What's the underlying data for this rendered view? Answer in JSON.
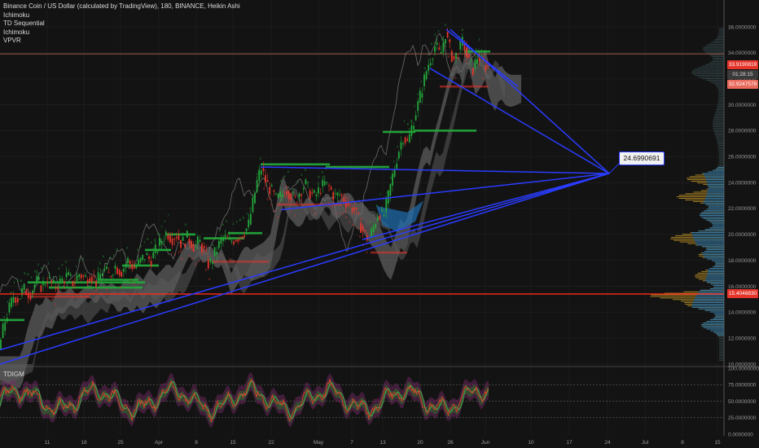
{
  "legend": {
    "title": "Binance Coin / US Dollar (calculated by TradingView), 180, BINANCE, Heikin Ashi",
    "indicators": [
      "Ichimoku",
      "TD Sequential",
      "Ichimoku",
      "VPVR"
    ]
  },
  "lower_pane": {
    "label": "TDIGM"
  },
  "price_tags": {
    "current": "33.9190819",
    "countdown": "01:28:15",
    "second": "32.9247578",
    "support": "15.4048830"
  },
  "callout_value": "24.6990691",
  "colors": {
    "background": "#131313",
    "trendline": "#2a3cff",
    "support_line": "#ff2a1a",
    "bull": "#23a63a",
    "bear": "#e5352b",
    "cloud_light": "#8c8c8c",
    "cloud_blue": "#1f6fb2",
    "vpvr_blue": "#2a86c8",
    "vpvr_gold": "#d4a32a"
  },
  "chart_data": {
    "type": "candlestick",
    "x_tick_labels": [
      "11",
      "18",
      "25",
      "Apr",
      "8",
      "15",
      "22",
      "May",
      "7",
      "13",
      "20",
      "26",
      "Jun",
      "10",
      "17",
      "24",
      "Jul",
      "8",
      "15"
    ],
    "y_tick_labels": [
      "36.0000000",
      "34.0000000",
      "32.0000000",
      "30.0000000",
      "28.0000000",
      "26.0000000",
      "24.0000000",
      "22.0000000",
      "20.0000000",
      "18.0000000",
      "16.0000000",
      "14.0000000",
      "12.0000000",
      "10.0000000"
    ],
    "ylim": [
      10,
      36.3
    ],
    "support_level": 15.404883,
    "price_path": [
      [
        0,
        11.2
      ],
      [
        8,
        13.5
      ],
      [
        14,
        14.5
      ],
      [
        18,
        15.3
      ],
      [
        24,
        15.0
      ],
      [
        30,
        15.8
      ],
      [
        38,
        15.4
      ],
      [
        46,
        16.4
      ],
      [
        52,
        16.0
      ],
      [
        60,
        16.6
      ],
      [
        68,
        15.9
      ],
      [
        76,
        16.4
      ],
      [
        84,
        16.8
      ],
      [
        92,
        16.2
      ],
      [
        98,
        17.0
      ],
      [
        105,
        16.6
      ],
      [
        112,
        16.9
      ],
      [
        120,
        16.3
      ],
      [
        128,
        17.3
      ],
      [
        136,
        16.8
      ],
      [
        142,
        17.6
      ],
      [
        150,
        17.1
      ],
      [
        158,
        18.0
      ],
      [
        166,
        17.4
      ],
      [
        172,
        17.8
      ],
      [
        180,
        18.4
      ],
      [
        186,
        18.0
      ],
      [
        194,
        18.9
      ],
      [
        200,
        19.6
      ],
      [
        206,
        20.2
      ],
      [
        212,
        19.7
      ],
      [
        218,
        20.0
      ],
      [
        224,
        19.3
      ],
      [
        232,
        19.8
      ],
      [
        240,
        19.0
      ],
      [
        246,
        19.5
      ],
      [
        252,
        18.6
      ],
      [
        258,
        17.6
      ],
      [
        264,
        18.4
      ],
      [
        270,
        19.2
      ],
      [
        276,
        19.8
      ],
      [
        282,
        19.4
      ],
      [
        290,
        19.7
      ],
      [
        298,
        20.0
      ],
      [
        306,
        20.6
      ],
      [
        312,
        22.5
      ],
      [
        318,
        24.4
      ],
      [
        322,
        25.1
      ],
      [
        328,
        24.0
      ],
      [
        334,
        23.4
      ],
      [
        340,
        22.7
      ],
      [
        346,
        22.9
      ],
      [
        352,
        23.6
      ],
      [
        358,
        23.1
      ],
      [
        364,
        22.6
      ],
      [
        370,
        23.4
      ],
      [
        376,
        23.9
      ],
      [
        382,
        23.2
      ],
      [
        388,
        22.9
      ],
      [
        394,
        23.5
      ],
      [
        400,
        23.9
      ],
      [
        406,
        23.6
      ],
      [
        412,
        22.9
      ],
      [
        418,
        23.1
      ],
      [
        424,
        22.7
      ],
      [
        430,
        22.2
      ],
      [
        436,
        22.0
      ],
      [
        442,
        21.0
      ],
      [
        448,
        20.1
      ],
      [
        454,
        19.6
      ],
      [
        460,
        20.6
      ],
      [
        466,
        21.8
      ],
      [
        472,
        21.3
      ],
      [
        478,
        22.9
      ],
      [
        484,
        24.7
      ],
      [
        490,
        26.3
      ],
      [
        496,
        27.6
      ],
      [
        502,
        27.0
      ],
      [
        508,
        28.6
      ],
      [
        514,
        29.9
      ],
      [
        520,
        31.4
      ],
      [
        526,
        32.9
      ],
      [
        530,
        33.6
      ],
      [
        536,
        34.6
      ],
      [
        542,
        33.7
      ],
      [
        548,
        35.6
      ],
      [
        552,
        34.6
      ],
      [
        558,
        33.4
      ],
      [
        564,
        34.1
      ],
      [
        570,
        34.9
      ],
      [
        576,
        33.3
      ],
      [
        582,
        32.7
      ],
      [
        588,
        33.8
      ],
      [
        594,
        33.2
      ],
      [
        600,
        32.9
      ]
    ],
    "trend_lines_converging_at": 24.6990691,
    "lower_pane_levels": [
      "100.0000000",
      "75.0000000",
      "50.0000000",
      "25.0000000",
      "0.0000000"
    ],
    "lower_pane_ylim": [
      0,
      100
    ]
  }
}
